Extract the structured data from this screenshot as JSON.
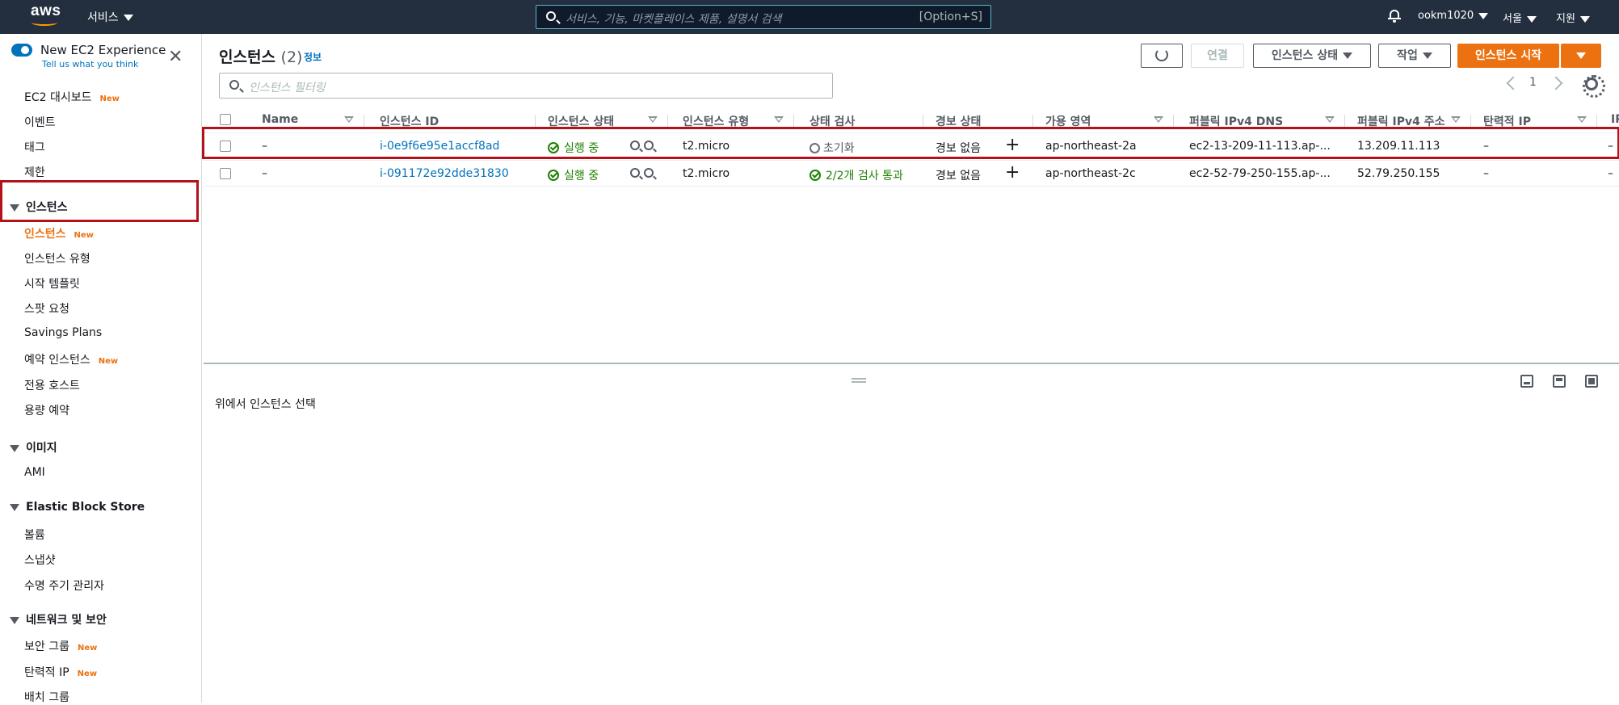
{
  "topbar": {
    "logo_text": "aws",
    "services_label": "서비스",
    "search_placeholder": "서비스, 기능, 마켓플레이스 제품, 설명서 검색",
    "search_shortcut": "[Option+S]",
    "user": "ookm1020",
    "region": "서울",
    "support": "지원",
    "bell_icon": "bell-icon"
  },
  "sidebar": {
    "new_experience_title": "New EC2 Experience",
    "new_experience_sub": "Tell us what you think",
    "new_badge": "New",
    "top_items": [
      {
        "label": "EC2 대시보드",
        "new": true
      },
      {
        "label": "이벤트",
        "new": false
      },
      {
        "label": "태그",
        "new": false
      },
      {
        "label": "제한",
        "new": false
      }
    ],
    "sections": [
      {
        "title": "인스턴스",
        "items": [
          {
            "label": "인스턴스",
            "new": true,
            "active": true
          },
          {
            "label": "인스턴스 유형",
            "new": false
          },
          {
            "label": "시작 템플릿",
            "new": false
          },
          {
            "label": "스팟 요청",
            "new": false
          },
          {
            "label": "Savings Plans",
            "new": false
          },
          {
            "label": "예약 인스턴스",
            "new": true
          },
          {
            "label": "전용 호스트",
            "new": false
          },
          {
            "label": "용량 예약",
            "new": false
          }
        ]
      },
      {
        "title": "이미지",
        "items": [
          {
            "label": "AMI",
            "new": false
          }
        ]
      },
      {
        "title": "Elastic Block Store",
        "items": [
          {
            "label": "볼륨",
            "new": false
          },
          {
            "label": "스냅샷",
            "new": false
          },
          {
            "label": "수명 주기 관리자",
            "new": false
          }
        ]
      },
      {
        "title": "네트워크 및 보안",
        "items": [
          {
            "label": "보안 그룹",
            "new": true
          },
          {
            "label": "탄력적 IP",
            "new": true
          },
          {
            "label": "배치 그룹",
            "new": false
          }
        ]
      }
    ]
  },
  "main": {
    "title": "인스턴스",
    "count": "(2)",
    "info_link": "정보",
    "buttons": {
      "connect": "연결",
      "instance_state": "인스턴스 상태",
      "actions": "작업",
      "launch": "인스턴스 시작"
    },
    "filter_placeholder": "인스턴스 필터링",
    "page_number": "1",
    "columns": [
      "Name",
      "인스턴스 ID",
      "인스턴스 상태",
      "인스턴스 유형",
      "상태 검사",
      "경보 상태",
      "가용 영역",
      "퍼블릭 IPv4 DNS",
      "퍼블릭 IPv4 주소",
      "탄력적 IP",
      "IP"
    ],
    "rows": [
      {
        "name": "–",
        "id": "i-0e9f6e95e1accf8ad",
        "state": "실행 중",
        "type": "t2.micro",
        "check": "초기화",
        "check_ok": false,
        "alarm": "경보 없음",
        "az": "ap-northeast-2a",
        "dns": "ec2-13-209-11-113.ap-...",
        "ip": "13.209.11.113",
        "eip": "–",
        "extra": "–"
      },
      {
        "name": "–",
        "id": "i-091172e92dde31830",
        "state": "실행 중",
        "type": "t2.micro",
        "check": "2/2개 검사 통과",
        "check_ok": true,
        "alarm": "경보 없음",
        "az": "ap-northeast-2c",
        "dns": "ec2-52-79-250-155.ap-...",
        "ip": "52.79.250.155",
        "eip": "–",
        "extra": "–"
      }
    ],
    "details_empty": "위에서 인스턴스 선택"
  },
  "colors": {
    "accent": "#ec7211",
    "link": "#0073bb",
    "success": "#1d8102",
    "header": "#232f3e",
    "highlight": "#b3121b"
  }
}
